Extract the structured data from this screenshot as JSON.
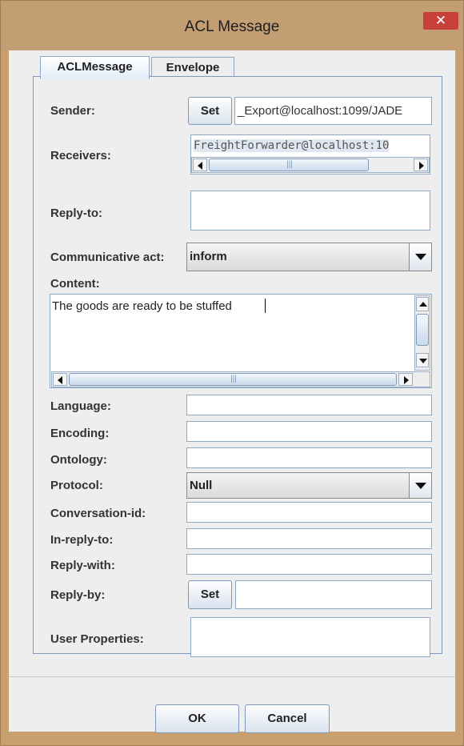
{
  "window": {
    "title": "ACL Message",
    "close_glyph": "✕"
  },
  "tabs": [
    {
      "label": "ACLMessage",
      "active": true
    },
    {
      "label": "Envelope",
      "active": false
    }
  ],
  "form": {
    "sender": {
      "label": "Sender:",
      "button": "Set",
      "value": "_Export@localhost:1099/JADE"
    },
    "receivers": {
      "label": "Receivers:",
      "value": "FreightForwarder@localhost:10"
    },
    "reply_to": {
      "label": "Reply-to:",
      "value": ""
    },
    "communicative_act": {
      "label": "Communicative act:",
      "value": "inform"
    },
    "content": {
      "label": "Content:",
      "value": "The goods are ready to be stuffed"
    },
    "language": {
      "label": "Language:",
      "value": ""
    },
    "encoding": {
      "label": "Encoding:",
      "value": ""
    },
    "ontology": {
      "label": "Ontology:",
      "value": ""
    },
    "protocol": {
      "label": "Protocol:",
      "value": "Null"
    },
    "conversation_id": {
      "label": "Conversation-id:",
      "value": ""
    },
    "in_reply_to": {
      "label": "In-reply-to:",
      "value": ""
    },
    "reply_with": {
      "label": "Reply-with:",
      "value": ""
    },
    "reply_by": {
      "label": "Reply-by:",
      "button": "Set",
      "value": ""
    },
    "user_properties": {
      "label": "User Properties:",
      "value": ""
    }
  },
  "footer": {
    "ok": "OK",
    "cancel": "Cancel"
  },
  "scroll_grip": "|||"
}
